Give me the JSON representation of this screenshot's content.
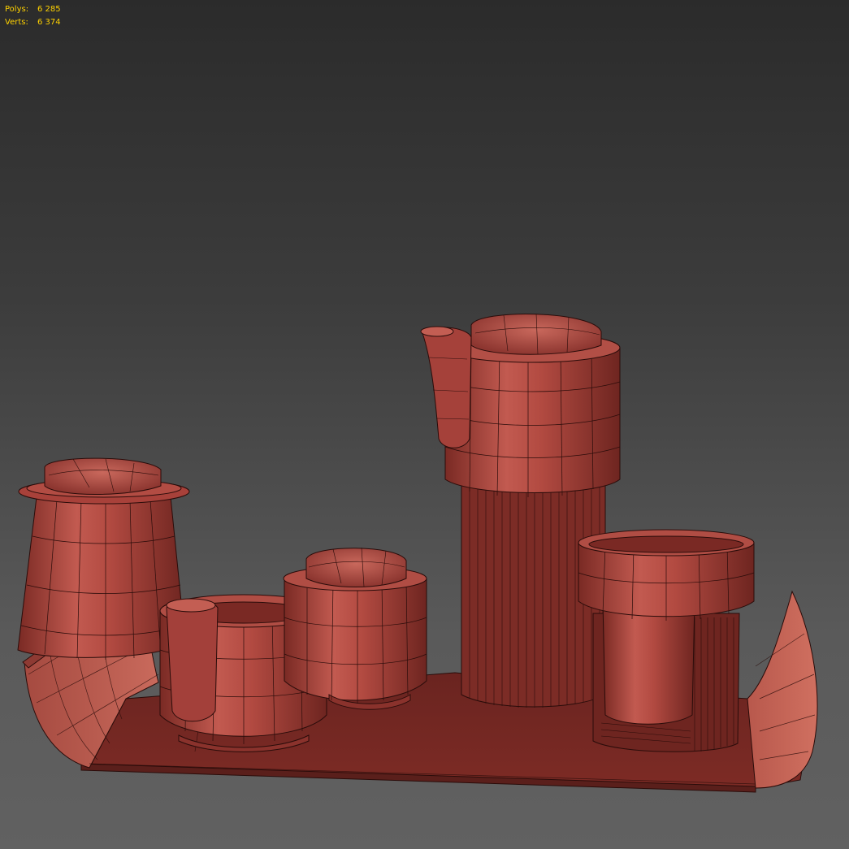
{
  "stats": {
    "polys_label": "Polys:",
    "polys_value": "6 285",
    "verts_label": "Verts:",
    "verts_value": "6 374"
  },
  "colors": {
    "background_top": "#2b2b2b",
    "background_bottom": "#616161",
    "stats_text": "#ffd200",
    "model_fill": "#a8413a",
    "model_light": "#c45a4f",
    "model_dark": "#6a2621",
    "wire": "#2a0c0a"
  },
  "viewport": {
    "mode": "wireframe-over-shaded",
    "objects": [
      "tray",
      "sugar-jar",
      "creamer-cup",
      "small-jar",
      "tall-pitcher",
      "cup-with-holder"
    ]
  }
}
